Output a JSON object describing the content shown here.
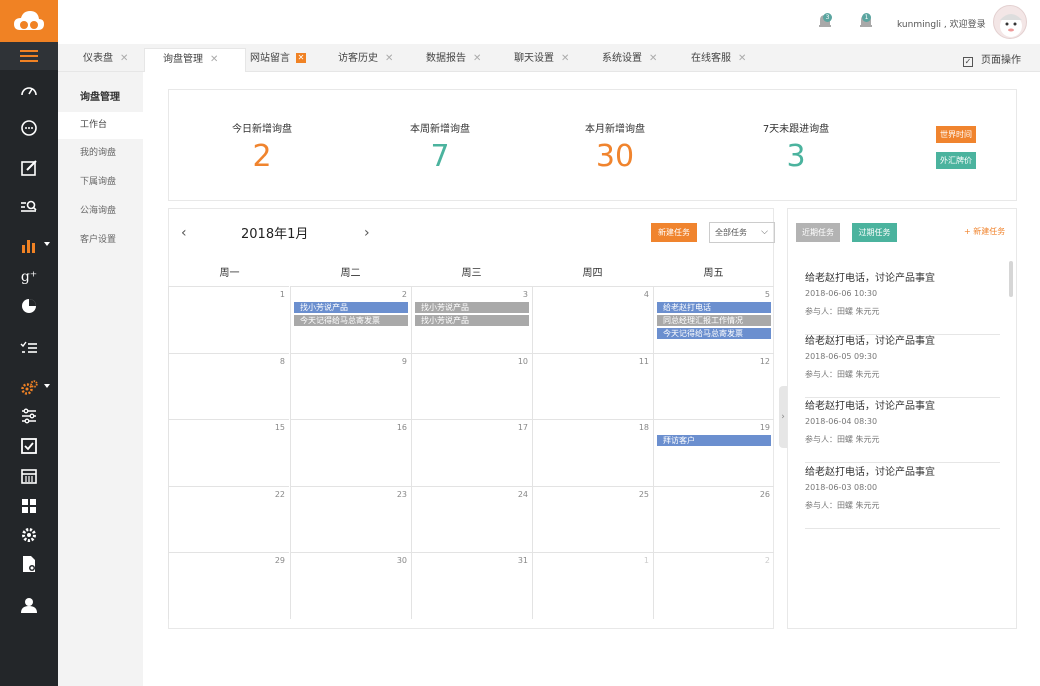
{
  "header": {
    "notifications": [
      {
        "icon": "bell-icon",
        "count": "3"
      },
      {
        "icon": "bell-icon",
        "count": "1"
      }
    ],
    "user_text": "kunmingli , 欢迎登录"
  },
  "tabs": [
    {
      "label": "仪表盘",
      "close": "✕"
    },
    {
      "label": "询盘管理",
      "close": "✕"
    },
    {
      "label": "网站留言",
      "close": "✕"
    },
    {
      "label": "访客历史",
      "close": "✕"
    },
    {
      "label": "数据报告",
      "close": "✕"
    },
    {
      "label": "聊天设置",
      "close": "✕"
    },
    {
      "label": "系统设置",
      "close": "✕"
    },
    {
      "label": "在线客服",
      "close": "✕"
    }
  ],
  "page_operation": {
    "check": "✓",
    "label": "页面操作"
  },
  "subnav": {
    "title": "询盘管理",
    "items": [
      "工作台",
      "我的询盘",
      "下属询盘",
      "公海询盘",
      "客户设置"
    ]
  },
  "stats": [
    {
      "label": "今日新增询盘",
      "value": "2",
      "color": "orange"
    },
    {
      "label": "本周新增询盘",
      "value": "7",
      "color": "teal"
    },
    {
      "label": "本月新增询盘",
      "value": "30",
      "color": "orange"
    },
    {
      "label": "7天未跟进询盘",
      "value": "3",
      "color": "teal"
    }
  ],
  "stat_buttons": {
    "world_time": "世界时间",
    "exchange_rate": "外汇牌价"
  },
  "calendar": {
    "prev": "‹",
    "next": "›",
    "month": "2018年1月",
    "new_task": "新建任务",
    "filter": "全部任务",
    "filter_chevron": "⌵",
    "weekdays": [
      "周一",
      "周二",
      "周三",
      "周四",
      "周五"
    ],
    "weeks": [
      [
        {
          "d": "1"
        },
        {
          "d": "2",
          "events": [
            {
              "t": "找小芳说产品",
              "c": "blue"
            },
            {
              "t": "今天记得给马总寄发票",
              "c": "gray"
            }
          ]
        },
        {
          "d": "3",
          "events": [
            {
              "t": "找小芳说产品",
              "c": "gray"
            },
            {
              "t": "找小芳说产品",
              "c": "gray"
            }
          ]
        },
        {
          "d": "4"
        },
        {
          "d": "5",
          "events": [
            {
              "t": "给老赵打电话",
              "c": "blue"
            },
            {
              "t": "同总经理汇报工作情况",
              "c": "gray"
            },
            {
              "t": "今天记得给马总寄发票",
              "c": "blue"
            }
          ]
        }
      ],
      [
        {
          "d": "8"
        },
        {
          "d": "9"
        },
        {
          "d": "10"
        },
        {
          "d": "11"
        },
        {
          "d": "12"
        }
      ],
      [
        {
          "d": "15"
        },
        {
          "d": "16"
        },
        {
          "d": "17"
        },
        {
          "d": "18"
        },
        {
          "d": "19",
          "events": [
            {
              "t": "拜访客户",
              "c": "blue"
            }
          ]
        }
      ],
      [
        {
          "d": "22"
        },
        {
          "d": "23"
        },
        {
          "d": "24"
        },
        {
          "d": "25"
        },
        {
          "d": "26"
        }
      ],
      [
        {
          "d": "29"
        },
        {
          "d": "30"
        },
        {
          "d": "31"
        },
        {
          "d": "1",
          "dim": true
        },
        {
          "d": "2",
          "dim": true
        }
      ]
    ]
  },
  "tasks_panel": {
    "recent": "近期任务",
    "overdue": "过期任务",
    "new_task": "+ 新建任务",
    "collapse": "›",
    "items": [
      {
        "title": "给老赵打电话，讨论产品事宜",
        "time": "2018-06-06  10:30",
        "people": "参与人：田螺     朱元元"
      },
      {
        "title": "给老赵打电话，讨论产品事宜",
        "time": "2018-06-05  09:30",
        "people": "参与人：田螺     朱元元"
      },
      {
        "title": "给老赵打电话，讨论产品事宜",
        "time": "2018-06-04  08:30",
        "people": "参与人：田螺     朱元元"
      },
      {
        "title": "给老赵打电话，讨论产品事宜",
        "time": "2018-06-03  08:00",
        "people": "参与人：田螺     朱元元"
      }
    ]
  },
  "colors": {
    "accent_orange": "#f08224",
    "teal": "#4bb39e",
    "event_blue": "#6b8fcf",
    "event_gray": "#a9a9a9",
    "sidebar_bg": "#232629"
  }
}
